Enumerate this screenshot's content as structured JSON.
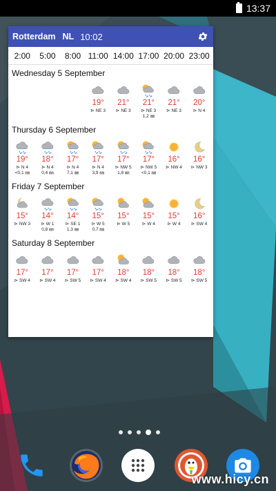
{
  "status_bar": {
    "time": "13:37"
  },
  "widget": {
    "city": "Rotterdam",
    "country": "NL",
    "time": "10:02",
    "hours": [
      "2:00",
      "5:00",
      "8:00",
      "11:00",
      "14:00",
      "17:00",
      "20:00",
      "23:00"
    ],
    "days": [
      {
        "title": "Wednesday 5 September",
        "cells": [
          null,
          null,
          null,
          {
            "icon": "cloud",
            "temp": "19°",
            "wind": "NE 3",
            "rain": ""
          },
          {
            "icon": "cloud",
            "temp": "21°",
            "wind": "NE 3",
            "rain": ""
          },
          {
            "icon": "sun-cloud-rain",
            "temp": "21°",
            "wind": "NE 3",
            "rain": "1,2 ㎜"
          },
          {
            "icon": "cloud",
            "temp": "21°",
            "wind": "NE 3",
            "rain": ""
          },
          {
            "icon": "cloud",
            "temp": "20°",
            "wind": "N 4",
            "rain": ""
          }
        ]
      },
      {
        "title": "Thursday 6 September",
        "cells": [
          {
            "icon": "rain",
            "temp": "19°",
            "wind": "N 4",
            "rain": "<0,1 ㎜"
          },
          {
            "icon": "rain",
            "temp": "18°",
            "wind": "N 4",
            "rain": "0,4 ㎜"
          },
          {
            "icon": "sun-cloud-rain",
            "temp": "17°",
            "wind": "N 4",
            "rain": "7,1 ㎜"
          },
          {
            "icon": "sun-cloud-rain",
            "temp": "17°",
            "wind": "N 4",
            "rain": "3,9 ㎜"
          },
          {
            "icon": "sun-cloud-rain",
            "temp": "17°",
            "wind": "NW 5",
            "rain": "1,8 ㎜"
          },
          {
            "icon": "sun-cloud-rain",
            "temp": "17°",
            "wind": "NW 5",
            "rain": "<0,1 ㎜"
          },
          {
            "icon": "sun",
            "temp": "16°",
            "wind": "NW 4",
            "rain": ""
          },
          {
            "icon": "moon",
            "temp": "16°",
            "wind": "NW 3",
            "rain": ""
          }
        ]
      },
      {
        "title": "Friday 7 September",
        "cells": [
          {
            "icon": "moon-cloud",
            "temp": "15°",
            "wind": "NW 3",
            "rain": ""
          },
          {
            "icon": "rain",
            "temp": "14°",
            "wind": "W 1",
            "rain": "0,8 ㎜"
          },
          {
            "icon": "sun-cloud-rain",
            "temp": "14°",
            "wind": "SE 1",
            "rain": "1,3 ㎜"
          },
          {
            "icon": "sun-cloud-rain",
            "temp": "15°",
            "wind": "W 5",
            "rain": "0,7 ㎜"
          },
          {
            "icon": "sun-cloud",
            "temp": "15°",
            "wind": "W 5",
            "rain": ""
          },
          {
            "icon": "sun-cloud",
            "temp": "15°",
            "wind": "W 4",
            "rain": ""
          },
          {
            "icon": "sun",
            "temp": "15°",
            "wind": "W 4",
            "rain": ""
          },
          {
            "icon": "moon",
            "temp": "16°",
            "wind": "SW 4",
            "rain": ""
          }
        ]
      },
      {
        "title": "Saturday 8 September",
        "cells": [
          {
            "icon": "cloud",
            "temp": "17°",
            "wind": "SW 4",
            "rain": ""
          },
          {
            "icon": "cloud",
            "temp": "17°",
            "wind": "SW 4",
            "rain": ""
          },
          {
            "icon": "cloud",
            "temp": "17°",
            "wind": "SW 5",
            "rain": ""
          },
          {
            "icon": "cloud",
            "temp": "17°",
            "wind": "SW 4",
            "rain": ""
          },
          {
            "icon": "sun-cloud",
            "temp": "18°",
            "wind": "SW 4",
            "rain": ""
          },
          {
            "icon": "cloud",
            "temp": "18°",
            "wind": "SW 5",
            "rain": ""
          },
          {
            "icon": "cloud",
            "temp": "18°",
            "wind": "SW 5",
            "rain": ""
          },
          {
            "icon": "cloud",
            "temp": "18°",
            "wind": "SW 5",
            "rain": ""
          }
        ]
      }
    ]
  },
  "home": {
    "page_count": 5,
    "active_page": 4,
    "dock": [
      {
        "name": "phone-icon",
        "color": "#2196f3"
      },
      {
        "name": "firefox-icon",
        "color": "#e66000"
      },
      {
        "name": "app-drawer-icon",
        "color": "#ffffff"
      },
      {
        "name": "duckduckgo-icon",
        "color": "#de5833"
      },
      {
        "name": "camera-icon",
        "color": "#1e88e5"
      }
    ]
  },
  "watermark": "www.hicy.cn",
  "colors": {
    "header": "#3f51b5",
    "temp": "#e53935",
    "teal": "#3cb6c8"
  }
}
